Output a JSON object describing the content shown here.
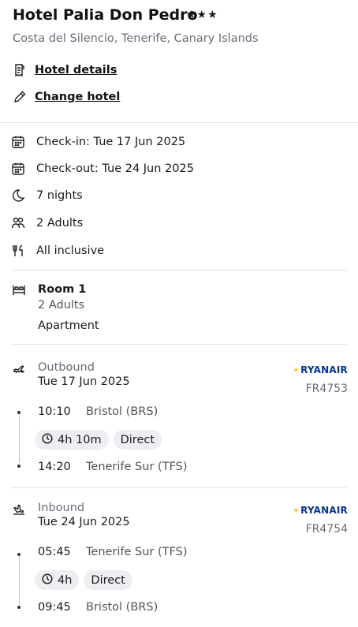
{
  "hotel": {
    "name": "Hotel Palia Don Pedro",
    "stars": "★★★",
    "location": "Costa del Silencio, Tenerife, Canary Islands",
    "details_link": "Hotel details",
    "change_link": "Change hotel"
  },
  "stay": {
    "checkin": "Check-in: Tue 17 Jun 2025",
    "checkout": "Check-out: Tue 24 Jun 2025",
    "nights": "7 nights",
    "guests": "2 Adults",
    "board": "All inclusive"
  },
  "room": {
    "title": "Room 1",
    "guests": "2 Adults",
    "type": "Apartment"
  },
  "outbound": {
    "label": "Outbound",
    "date": "Tue 17 Jun 2025",
    "airline": "RYANAIR",
    "flight_no": "FR4753",
    "depart_time": "10:10",
    "depart_airport": "Bristol (BRS)",
    "duration": "4h 10m",
    "stops": "Direct",
    "arrive_time": "14:20",
    "arrive_airport": "Tenerife Sur (TFS)"
  },
  "inbound": {
    "label": "Inbound",
    "date": "Tue 24 Jun 2025",
    "airline": "RYANAIR",
    "flight_no": "FR4754",
    "depart_time": "05:45",
    "depart_airport": "Tenerife Sur (TFS)",
    "duration": "4h",
    "stops": "Direct",
    "arrive_time": "09:45",
    "arrive_airport": "Bristol (BRS)"
  },
  "colors": {
    "airline_blue": "#073590",
    "airline_yellow": "#f1c933",
    "muted_text": "#6b6b78",
    "chip_bg": "#eeeef2"
  },
  "icons": [
    "receipt-icon",
    "pencil-icon",
    "calendar-icon",
    "moon-icon",
    "people-icon",
    "fork-knife-icon",
    "bed-icon",
    "plane-depart-icon",
    "plane-arrive-icon",
    "clock-icon"
  ]
}
